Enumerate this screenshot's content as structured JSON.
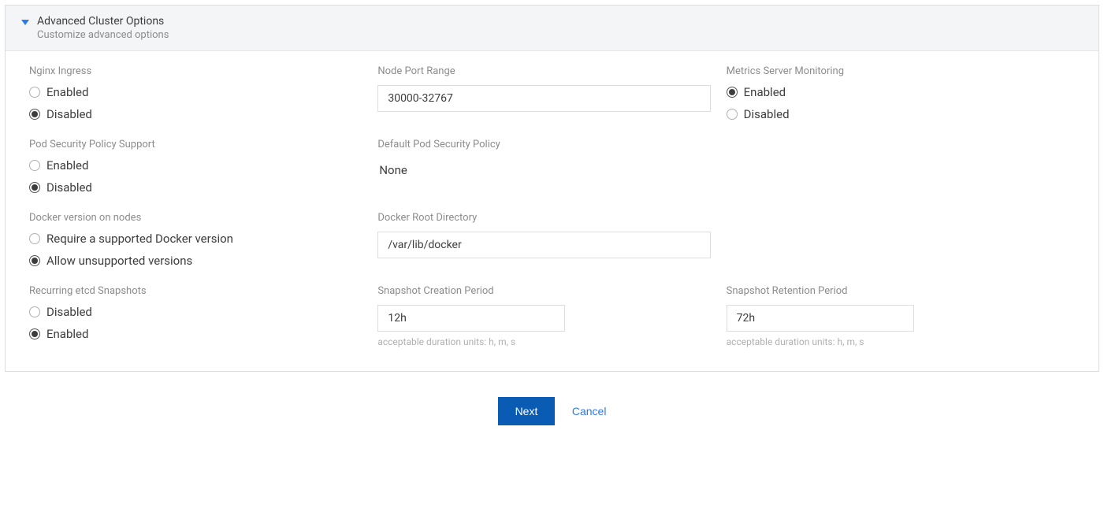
{
  "panel": {
    "title": "Advanced Cluster Options",
    "subtitle": "Customize advanced options"
  },
  "nginx_ingress": {
    "label": "Nginx Ingress",
    "opt_enabled": "Enabled",
    "opt_disabled": "Disabled"
  },
  "node_port_range": {
    "label": "Node Port Range",
    "value": "30000-32767"
  },
  "metrics_server": {
    "label": "Metrics Server Monitoring",
    "opt_enabled": "Enabled",
    "opt_disabled": "Disabled"
  },
  "pod_security_policy": {
    "label": "Pod Security Policy Support",
    "opt_enabled": "Enabled",
    "opt_disabled": "Disabled"
  },
  "default_pod_security": {
    "label": "Default Pod Security Policy",
    "value": "None"
  },
  "docker_version": {
    "label": "Docker version on nodes",
    "opt_require": "Require a supported Docker version",
    "opt_allow": "Allow unsupported versions"
  },
  "docker_root_dir": {
    "label": "Docker Root Directory",
    "value": "/var/lib/docker"
  },
  "etcd_snapshots": {
    "label": "Recurring etcd Snapshots",
    "opt_disabled": "Disabled",
    "opt_enabled": "Enabled"
  },
  "snapshot_creation": {
    "label": "Snapshot Creation Period",
    "value": "12h",
    "hint": "acceptable duration units: h, m, s"
  },
  "snapshot_retention": {
    "label": "Snapshot Retention Period",
    "value": "72h",
    "hint": "acceptable duration units: h, m, s"
  },
  "footer": {
    "next": "Next",
    "cancel": "Cancel"
  }
}
